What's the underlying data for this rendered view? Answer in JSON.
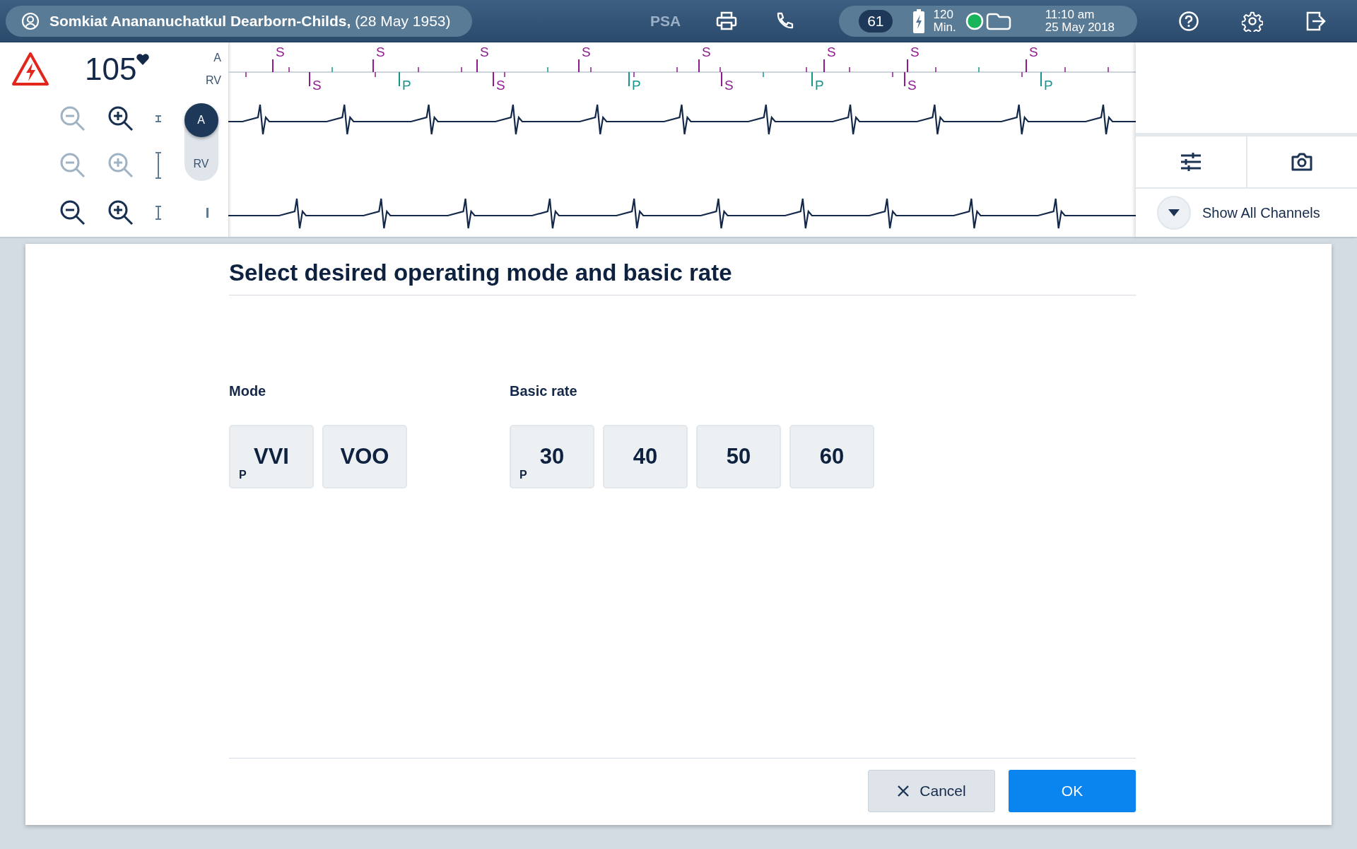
{
  "top_bar": {
    "patient": "**Somkiat Anananuchatkul Dearborn-Childs,** (28 May 1953)",
    "mode_tab": {
      "label": "PSA",
      "disabled": true
    },
    "status": {
      "badge": "61",
      "battery_value": "120",
      "battery_unit": "Min.",
      "connected": true,
      "time": "11:10 am",
      "date": "25 May 2018"
    }
  },
  "monitor": {
    "heart_rate": "105",
    "channel_labels": [
      "A",
      "RV"
    ],
    "zoom_rows": [
      {
        "zoom_out_disabled": true,
        "zoom_in_disabled": false
      },
      {
        "zoom_out_disabled": true,
        "zoom_in_disabled": true
      },
      {
        "zoom_out_disabled": false,
        "zoom_in_disabled": false
      }
    ],
    "channel_toggle": [
      {
        "label": "A",
        "selected": true
      },
      {
        "label": "RV",
        "selected": false
      }
    ],
    "markers_a": [
      {
        "label": "S",
        "color": "#8e1a8e"
      },
      {
        "label": "S",
        "color": "#8e1a8e"
      },
      {
        "label": "S",
        "color": "#8e1a8e"
      },
      {
        "label": "S",
        "color": "#8e1a8e"
      },
      {
        "label": "S",
        "color": "#8e1a8e"
      },
      {
        "label": "S",
        "color": "#8e1a8e"
      },
      {
        "label": "S",
        "color": "#8e1a8e"
      },
      {
        "label": "S",
        "color": "#8e1a8e"
      }
    ],
    "markers_rv": [
      {
        "label": "S",
        "color": "#8e1a8e"
      },
      {
        "label": "P",
        "color": "#14968f"
      },
      {
        "label": "S",
        "color": "#8e1a8e"
      },
      {
        "label": "P",
        "color": "#14968f"
      },
      {
        "label": "S",
        "color": "#8e1a8e"
      },
      {
        "label": "P",
        "color": "#14968f"
      },
      {
        "label": "S",
        "color": "#8e1a8e"
      },
      {
        "label": "P",
        "color": "#14968f"
      }
    ],
    "show_channels": "Show All Channels"
  },
  "dialog": {
    "title": "Select desired operating mode and basic rate",
    "groups": [
      {
        "label": "Mode",
        "options": [
          {
            "value": "VVI",
            "tag": "P"
          },
          {
            "value": "VOO"
          }
        ]
      },
      {
        "label": "Basic rate",
        "options": [
          {
            "value": "30",
            "tag": "P"
          },
          {
            "value": "40"
          },
          {
            "value": "50"
          },
          {
            "value": "60"
          }
        ]
      }
    ],
    "buttons": [
      {
        "label": "Cancel",
        "kind": "secondary"
      },
      {
        "label": "OK",
        "kind": "primary"
      }
    ]
  }
}
